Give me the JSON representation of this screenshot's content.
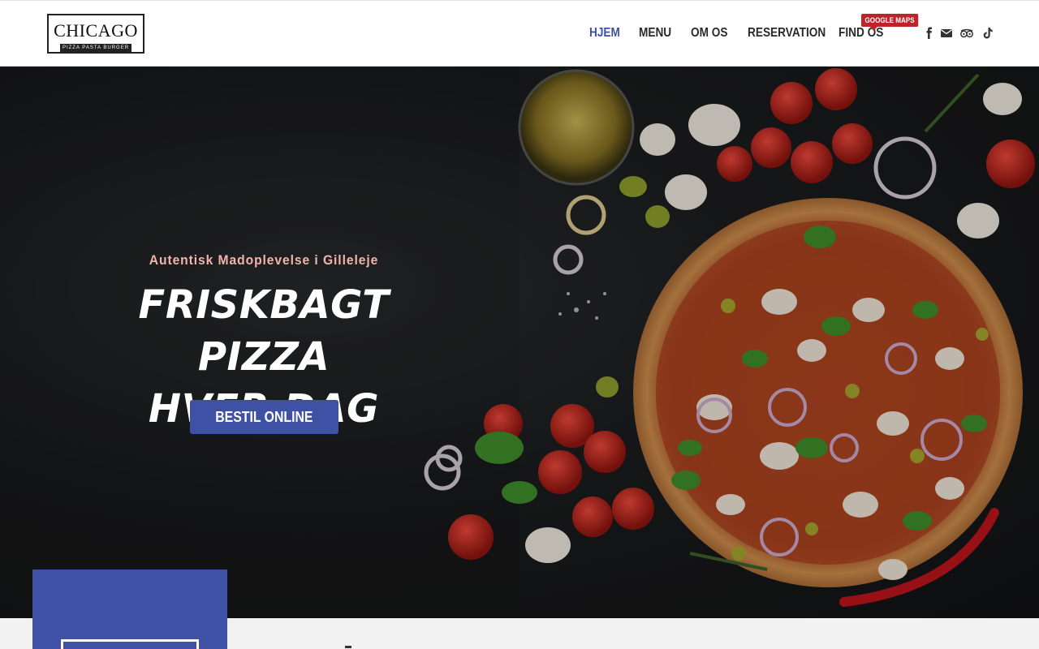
{
  "logo": {
    "name": "CHICAGO",
    "tagline": "PIZZA PASTA BURGER"
  },
  "nav": {
    "items": [
      {
        "label": "HJEM",
        "active": true
      },
      {
        "label": "MENU",
        "active": false
      },
      {
        "label": "OM OS",
        "active": false
      },
      {
        "label": "RESERVATION",
        "active": false
      },
      {
        "label": "FIND OS",
        "active": false
      }
    ],
    "badge": "GOOGLE MAPS"
  },
  "social": [
    "facebook-icon",
    "envelope-icon",
    "tripadvisor-icon",
    "tiktok-icon"
  ],
  "hero": {
    "kicker": "Autentisk Madoplevelse i Gilleleje",
    "headline_line1": "FRISKBAGT PIZZA",
    "headline_line2": "HVER DAG",
    "cta": "BESTIL ONLINE"
  },
  "colors": {
    "accent": "#3f51a4",
    "badge": "#c0222a",
    "kicker": "#f3b3ad"
  }
}
